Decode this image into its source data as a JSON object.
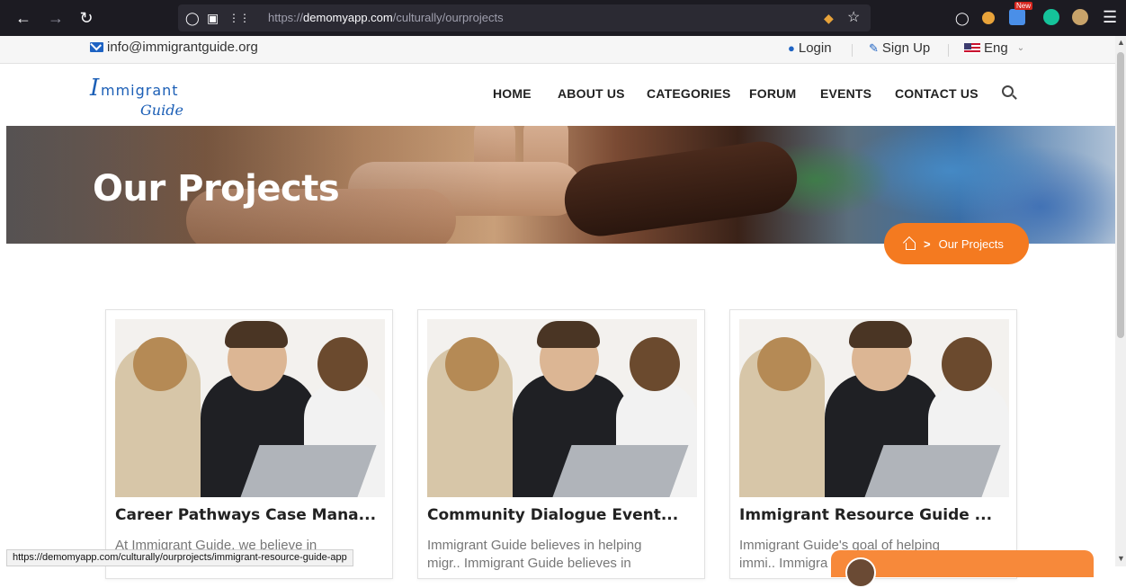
{
  "browser": {
    "url_prefix": "https://",
    "url_domain": "demomyapp.com",
    "url_path": "/culturally/ourprojects",
    "new_badge": "New"
  },
  "topbar": {
    "email": "info@immigrantguide.org",
    "login": "Login",
    "signup": "Sign Up",
    "language": "Eng"
  },
  "logo": {
    "line1_initial": "I",
    "line1_rest": "mmigrant",
    "line2": "Guide"
  },
  "nav": {
    "items": [
      "HOME",
      "ABOUT US",
      "CATEGORIES",
      "FORUM",
      "EVENTS",
      "CONTACT US"
    ]
  },
  "hero": {
    "title": "Our Projects",
    "breadcrumb_separator": ">",
    "breadcrumb_current": "Our Projects"
  },
  "cards": [
    {
      "title": "Career Pathways Case Mana...",
      "text_line1": "At Immigrant Guide, we believe in",
      "text_line2": ""
    },
    {
      "title": "Community Dialogue Event...",
      "text_line1": "Immigrant Guide believes in helping",
      "text_line2": "migr.. Immigrant Guide believes in"
    },
    {
      "title": "Immigrant Resource Guide ...",
      "text_line1": "Immigrant Guide's goal of helping",
      "text_line2": "immi.. Immigra"
    }
  ],
  "status_bar": {
    "url": "https://demomyapp.com/culturally/ourprojects/immigrant-resource-guide-app"
  },
  "colors": {
    "accent": "#f47a20",
    "brand_blue": "#1c5fb6",
    "chrome_dark": "#1c1b22"
  },
  "icons": [
    "back-icon",
    "forward-icon",
    "reload-icon",
    "shield-icon",
    "lock-icon",
    "permissions-icon",
    "bookmark-star-icon",
    "pocket-icon",
    "menu-icon",
    "envelope-icon",
    "user-icon",
    "edit-icon",
    "flag-icon",
    "chevron-down-icon",
    "search-icon",
    "home-icon"
  ]
}
